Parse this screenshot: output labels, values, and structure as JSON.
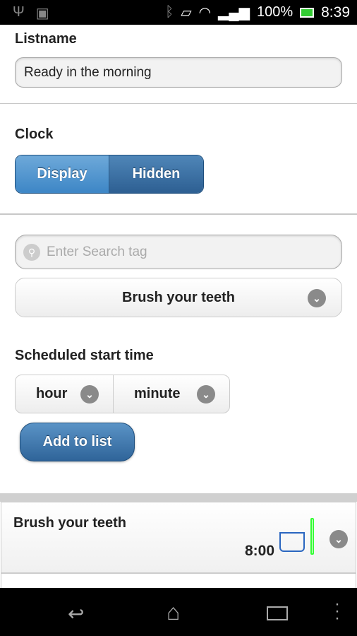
{
  "status_bar": {
    "battery": "100%",
    "time": "8:39",
    "icons": [
      "usb-icon",
      "android-icon",
      "bluetooth-icon",
      "vibrate-icon",
      "wifi-icon",
      "signal-icon",
      "battery-charging-icon"
    ]
  },
  "listname": {
    "label": "Listname",
    "value": "Ready in the morning"
  },
  "clock": {
    "label": "Clock",
    "options": [
      "Display",
      "Hidden"
    ],
    "selected": "Display"
  },
  "search": {
    "placeholder": "Enter Search tag"
  },
  "task_select": {
    "value": "Brush your teeth"
  },
  "schedule": {
    "label": "Scheduled start time",
    "hour": "hour",
    "minute": "minute"
  },
  "add_button": "Add to list",
  "list": [
    {
      "title": "Brush your teeth",
      "time": "8:00",
      "icon": "toothbrush-cup-icon"
    }
  ],
  "colors": {
    "accent": "#3d86c6",
    "dark_accent": "#2d5f92"
  }
}
